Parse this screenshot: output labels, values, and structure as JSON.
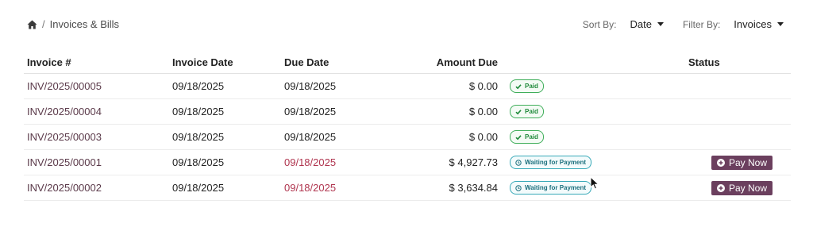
{
  "breadcrumb": {
    "home_icon": "home-icon",
    "separator": "/",
    "current": "Invoices & Bills"
  },
  "controls": {
    "sort_label": "Sort By:",
    "sort_value": "Date",
    "filter_label": "Filter By:",
    "filter_value": "Invoices"
  },
  "table": {
    "headers": {
      "invoice_num": "Invoice #",
      "invoice_date": "Invoice Date",
      "due_date": "Due Date",
      "amount_due": "Amount Due",
      "status": "Status"
    },
    "rows": [
      {
        "invoice_num": "INV/2025/00005",
        "invoice_date": "09/18/2025",
        "due_date": "09/18/2025",
        "amount_due": "$ 0.00",
        "payment_state": "Paid",
        "overdue": false,
        "action": ""
      },
      {
        "invoice_num": "INV/2025/00004",
        "invoice_date": "09/18/2025",
        "due_date": "09/18/2025",
        "amount_due": "$ 0.00",
        "payment_state": "Paid",
        "overdue": false,
        "action": ""
      },
      {
        "invoice_num": "INV/2025/00003",
        "invoice_date": "09/18/2025",
        "due_date": "09/18/2025",
        "amount_due": "$ 0.00",
        "payment_state": "Paid",
        "overdue": false,
        "action": ""
      },
      {
        "invoice_num": "INV/2025/00001",
        "invoice_date": "09/18/2025",
        "due_date": "09/18/2025",
        "amount_due": "$ 4,927.73",
        "payment_state": "Waiting for Payment",
        "overdue": true,
        "action": "Pay Now"
      },
      {
        "invoice_num": "INV/2025/00002",
        "invoice_date": "09/18/2025",
        "due_date": "09/18/2025",
        "amount_due": "$ 3,634.84",
        "payment_state": "Waiting for Payment",
        "overdue": true,
        "action": "Pay Now"
      }
    ]
  },
  "colors": {
    "accent": "#6b3f5e",
    "overdue": "#b0354f",
    "paid": "#1f8a3a",
    "waiting": "#1b6f7d"
  }
}
